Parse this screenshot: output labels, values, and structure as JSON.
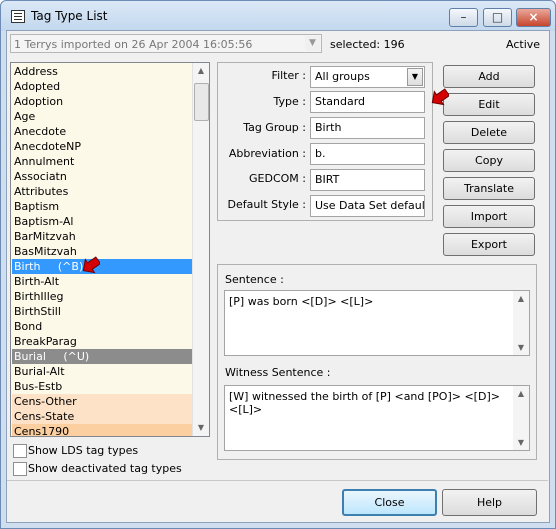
{
  "window": {
    "title": "Tag Type List",
    "min_icon": "minimize-icon",
    "max_icon": "maximize-icon",
    "close_icon": "close-icon"
  },
  "header": {
    "dataset_value": "1 Terrys imported on 26 Apr 2004 16:05:56",
    "selected_label": "selected: 196",
    "status": "Active"
  },
  "taglist": {
    "items": [
      {
        "label": "Address",
        "style": ""
      },
      {
        "label": "Adopted",
        "style": ""
      },
      {
        "label": "Adoption",
        "style": ""
      },
      {
        "label": "Age",
        "style": ""
      },
      {
        "label": "Anecdote",
        "style": ""
      },
      {
        "label": "AnecdoteNP",
        "style": ""
      },
      {
        "label": "Annulment",
        "style": ""
      },
      {
        "label": "Associatn",
        "style": ""
      },
      {
        "label": "Attributes",
        "style": ""
      },
      {
        "label": "Baptism",
        "style": ""
      },
      {
        "label": "Baptism-Al",
        "style": ""
      },
      {
        "label": "BarMitzvah",
        "style": ""
      },
      {
        "label": "BasMitzvah",
        "style": ""
      },
      {
        "label": "Birth     (^B)",
        "style": "sel"
      },
      {
        "label": "Birth-Alt",
        "style": ""
      },
      {
        "label": "BirthIlleg",
        "style": ""
      },
      {
        "label": "BirthStill",
        "style": ""
      },
      {
        "label": "Bond",
        "style": ""
      },
      {
        "label": "BreakParag",
        "style": ""
      },
      {
        "label": "Burial     (^U)",
        "style": "dark"
      },
      {
        "label": "Burial-Alt",
        "style": ""
      },
      {
        "label": "Bus-Estb",
        "style": ""
      },
      {
        "label": "Cens-Other",
        "style": "peach"
      },
      {
        "label": "Cens-State",
        "style": "peach"
      },
      {
        "label": "Cens1790",
        "style": "peach2"
      }
    ]
  },
  "options": {
    "show_lds": "Show LDS tag types",
    "show_deactivated": "Show deactivated tag types"
  },
  "fields": {
    "filter_label": "Filter :",
    "filter_value": "All groups",
    "type_label": "Type :",
    "type_value": "Standard",
    "group_label": "Tag Group :",
    "group_value": "Birth",
    "abbrev_label": "Abbreviation :",
    "abbrev_value": "b.",
    "gedcom_label": "GEDCOM :",
    "gedcom_value": "BIRT",
    "style_label": "Default Style :",
    "style_value": "Use Data Set default s"
  },
  "buttons": {
    "add": "Add",
    "edit": "Edit",
    "delete": "Delete",
    "copy": "Copy",
    "translate": "Translate",
    "import": "Import",
    "export": "Export",
    "close": "Close",
    "help": "Help"
  },
  "sentences": {
    "sentence_label": "Sentence :",
    "sentence_value": "[P] was born <[D]> <[L]>",
    "witness_label": "Witness Sentence :",
    "witness_value": "[W] witnessed the birth of [P] <and [PO]> <[D]> <[L]>"
  },
  "colors": {
    "selection": "#3399ff",
    "list_bg": "#fdf9e8",
    "marker": "#d40000"
  }
}
